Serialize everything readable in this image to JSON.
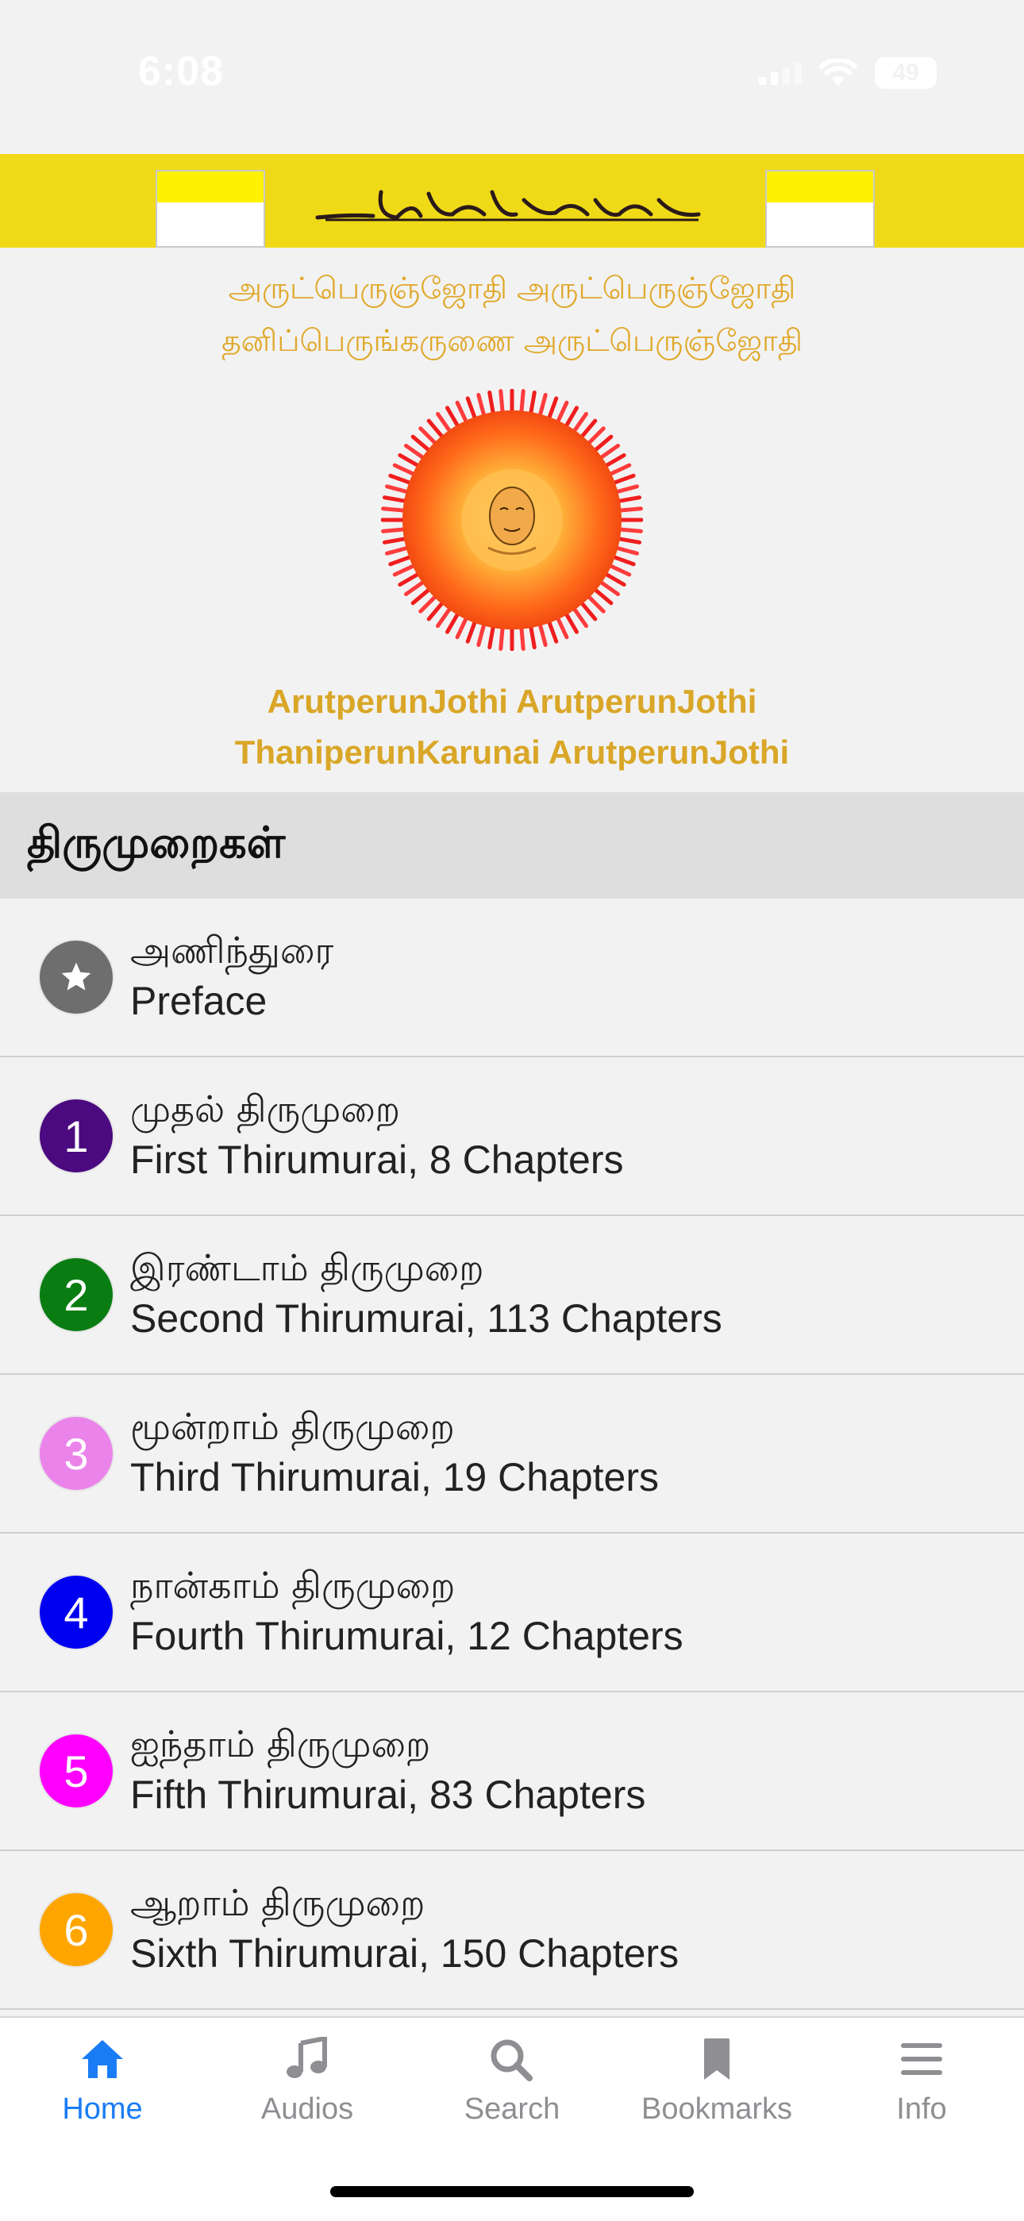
{
  "status_bar": {
    "time": "6:08",
    "battery": "49"
  },
  "banner": {
    "logo_alt": "Siddhivalagam"
  },
  "header": {
    "tamil_line1": "அருட்பெருஞ்ஜோதி அருட்பெருஞ்ஜோதி",
    "tamil_line2": "தனிப்பெருங்கருணை அருட்பெருஞ்ஜோதி",
    "english_line1": "ArutperunJothi ArutperunJothi",
    "english_line2": "ThaniperunKarunai ArutperunJothi"
  },
  "section": {
    "title": "திருமுறைகள்"
  },
  "items": [
    {
      "badge": "★",
      "color": "#6e6e6e",
      "title": "அணிந்துரை",
      "subtitle": "Preface"
    },
    {
      "badge": "1",
      "color": "#4b0a7f",
      "title": "முதல் திருமுறை",
      "subtitle": "First Thirumurai, 8 Chapters"
    },
    {
      "badge": "2",
      "color": "#0a7d12",
      "title": "இரண்டாம் திருமுறை",
      "subtitle": "Second Thirumurai, 113 Chapters"
    },
    {
      "badge": "3",
      "color": "#ea84ea",
      "title": "மூன்றாம் திருமுறை",
      "subtitle": "Third Thirumurai, 19 Chapters"
    },
    {
      "badge": "4",
      "color": "#0000f0",
      "title": "நான்காம் திருமுறை",
      "subtitle": "Fourth Thirumurai, 12 Chapters"
    },
    {
      "badge": "5",
      "color": "#ff00ff",
      "title": "ஐந்தாம் திருமுறை",
      "subtitle": "Fifth Thirumurai, 83 Chapters"
    },
    {
      "badge": "6",
      "color": "#ffa500",
      "title": "ஆறாம் திருமுறை",
      "subtitle": "Sixth Thirumurai, 150 Chapters"
    }
  ],
  "tabs": [
    {
      "label": "Home",
      "icon": "house-icon",
      "active": true
    },
    {
      "label": "Audios",
      "icon": "music-note-icon",
      "active": false
    },
    {
      "label": "Search",
      "icon": "magnifier-icon",
      "active": false
    },
    {
      "label": "Bookmarks",
      "icon": "bookmark-icon",
      "active": false
    },
    {
      "label": "Info",
      "icon": "hamburger-menu-icon",
      "active": false
    }
  ],
  "colors": {
    "accent": "#1a7cf5",
    "banner": "#f0da17",
    "gold_text": "#d9a627"
  }
}
